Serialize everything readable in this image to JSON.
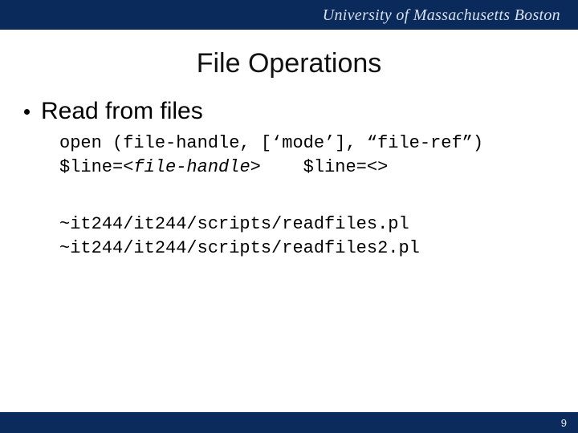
{
  "header": {
    "institution": "University of Massachusetts Boston"
  },
  "slide": {
    "title": "File Operations",
    "page_number": "9"
  },
  "bullets": [
    {
      "text": "Read from files"
    }
  ],
  "code": {
    "line1": "open (file-handle, [‘mode’], “file-ref”)",
    "line2_prefix": "$line=<",
    "line2_italic": "file-handle",
    "line2_suffix": ">    $line=<>",
    "path1": "~it244/it244/scripts/readfiles.pl",
    "path2": "~it244/it244/scripts/readfiles2.pl"
  }
}
